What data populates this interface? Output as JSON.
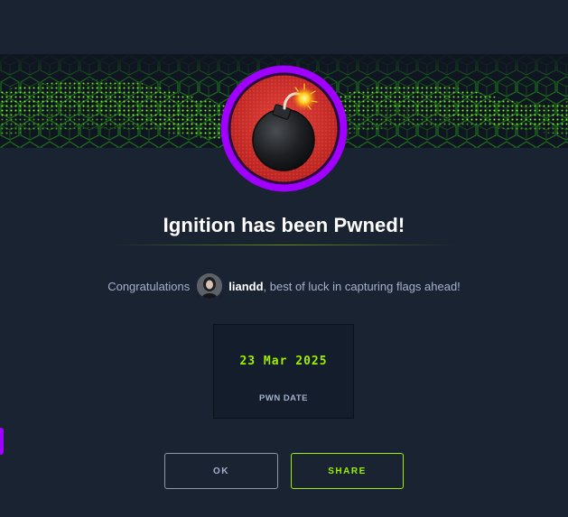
{
  "modal": {
    "title": "Ignition has been Pwned!",
    "congrats_prefix": "Congratulations",
    "username": "liandd",
    "congrats_suffix": ", best of luck in capturing flags ahead!",
    "pwn_date": "23 Mar 2025",
    "pwn_date_label": "PWN DATE",
    "ok_label": "OK",
    "share_label": "SHARE"
  },
  "icons": {
    "badge": "bomb-icon",
    "avatar": "user-avatar"
  },
  "colors": {
    "background": "#1a2332",
    "accent_green": "#9fef00",
    "badge_ring": "#9f00ff",
    "badge_fill": "#d42f2f",
    "text_muted": "#a4b1cd"
  }
}
